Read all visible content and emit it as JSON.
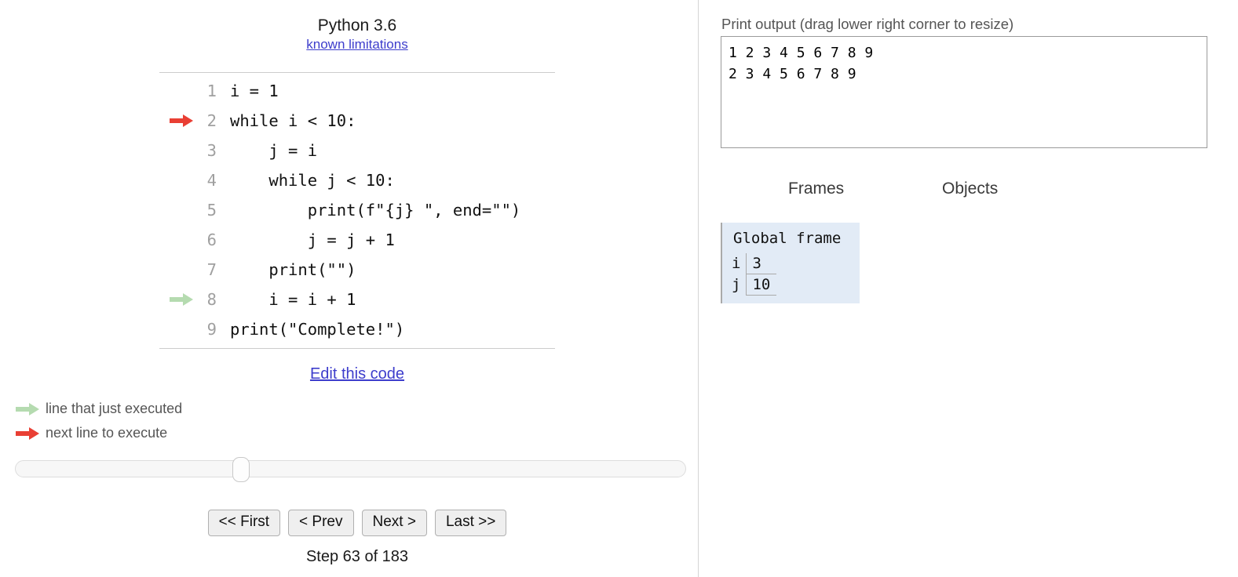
{
  "code_panel": {
    "python_version": "Python 3.6",
    "known_limitations_link": "known limitations",
    "edit_code_link": "Edit this code",
    "lines": [
      {
        "number": "1",
        "text": "i = 1",
        "arrow": "none"
      },
      {
        "number": "2",
        "text": "while i < 10:",
        "arrow": "next"
      },
      {
        "number": "3",
        "text": "    j = i",
        "arrow": "none"
      },
      {
        "number": "4",
        "text": "    while j < 10:",
        "arrow": "none"
      },
      {
        "number": "5",
        "text": "        print(f\"{j} \", end=\"\")",
        "arrow": "none"
      },
      {
        "number": "6",
        "text": "        j = j + 1",
        "arrow": "none"
      },
      {
        "number": "7",
        "text": "    print(\"\")",
        "arrow": "none"
      },
      {
        "number": "8",
        "text": "    i = i + 1",
        "arrow": "executed"
      },
      {
        "number": "9",
        "text": "print(\"Complete!\")",
        "arrow": "none"
      }
    ]
  },
  "legend": {
    "executed_label": "line that just executed",
    "next_label": "next line to execute",
    "executed_color": "#b5dbb0",
    "next_color": "#e93f34"
  },
  "controls": {
    "first_label": "<< First",
    "prev_label": "< Prev",
    "next_label": "Next >",
    "last_label": "Last >>",
    "step_label": "Step 63 of 183",
    "step_current": 63,
    "step_total": 183
  },
  "output_panel": {
    "print_output_label": "Print output (drag lower right corner to resize)",
    "print_output_text": "1 2 3 4 5 6 7 8 9 \n2 3 4 5 6 7 8 9 "
  },
  "visualization": {
    "frames_heading": "Frames",
    "objects_heading": "Objects",
    "frame_background_color": "#e2ebf6",
    "frames": [
      {
        "title": "Global frame",
        "variables": [
          {
            "name": "i",
            "value": "3"
          },
          {
            "name": "j",
            "value": "10"
          }
        ]
      }
    ],
    "objects": []
  }
}
